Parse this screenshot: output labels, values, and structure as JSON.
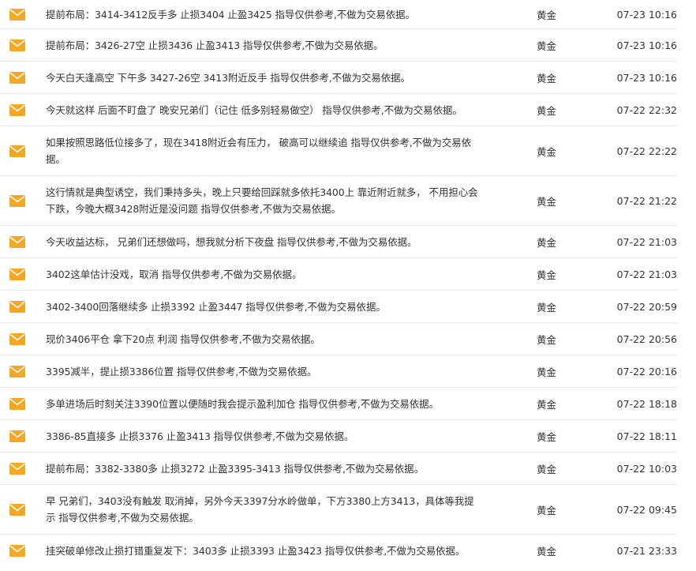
{
  "colors": {
    "icon": "#f5a623",
    "divider": "#e6e6e6",
    "text": "#333333"
  },
  "icon_name": "envelope-icon",
  "messages": [
    {
      "text": "提前布局：3414-3412反手多 止损3404 止盈3425 指导仅供参考,不做为交易依据。",
      "category": "黄金",
      "time": "07-23 10:16"
    },
    {
      "text": "提前布局：3426-27空 止损3436 止盈3413 指导仅供参考,不做为交易依据。",
      "category": "黄金",
      "time": "07-23 10:16"
    },
    {
      "text": "今天白天逢高空 下午多 3427-26空 3413附近反手 指导仅供参考,不做为交易依据。",
      "category": "黄金",
      "time": "07-23 10:16"
    },
    {
      "text": "今天就这样 后面不盯盘了 晚安兄弟们（记住 低多别轻易做空） 指导仅供参考,不做为交易依据。",
      "category": "黄金",
      "time": "07-22 22:32"
    },
    {
      "text": "如果按照思路低位接多了，现在3418附近会有压力， 破高可以继续追 指导仅供参考,不做为交易依据。",
      "category": "黄金",
      "time": "07-22 22:22"
    },
    {
      "text": "这行情就是典型诱空，我们秉持多头，晚上只要给回踩就多依托3400上 靠近附近就多， 不用担心会下跌，今晚大概3428附近是没问题 指导仅供参考,不做为交易依据。",
      "category": "黄金",
      "time": "07-22 21:22"
    },
    {
      "text": "今天收益达标， 兄弟们还想做吗，想我就分析下夜盘 指导仅供参考,不做为交易依据。",
      "category": "黄金",
      "time": "07-22 21:03"
    },
    {
      "text": "3402这单估计没戏，取消 指导仅供参考,不做为交易依据。",
      "category": "黄金",
      "time": "07-22 21:03"
    },
    {
      "text": "3402-3400回落继续多 止损3392 止盈3447 指导仅供参考,不做为交易依据。",
      "category": "黄金",
      "time": "07-22 20:59"
    },
    {
      "text": "现价3406平仓 拿下20点 利润 指导仅供参考,不做为交易依据。",
      "category": "黄金",
      "time": "07-22 20:56"
    },
    {
      "text": "3395减半，提止损3386位置 指导仅供参考,不做为交易依据。",
      "category": "黄金",
      "time": "07-22 20:16"
    },
    {
      "text": "多单进场后时刻关注3390位置以便随时我会提示盈利加仓 指导仅供参考,不做为交易依据。",
      "category": "黄金",
      "time": "07-22 18:18"
    },
    {
      "text": "3386-85直接多 止损3376 止盈3413 指导仅供参考,不做为交易依据。",
      "category": "黄金",
      "time": "07-22 18:11"
    },
    {
      "text": "提前布局：3382-3380多 止损3272 止盈3395-3413 指导仅供参考,不做为交易依据。",
      "category": "黄金",
      "time": "07-22 10:03"
    },
    {
      "text": "早 兄弟们，3403没有触发 取消掉，另外今天3397分水岭做单，下方3380上方3413，具体等我提示 指导仅供参考,不做为交易依据。",
      "category": "黄金",
      "time": "07-22 09:45"
    },
    {
      "text": "挂突破单修改止损打错重复发下：3403多 止损3393 止盈3423 指导仅供参考,不做为交易依据。",
      "category": "黄金",
      "time": "07-21 23:33"
    }
  ]
}
